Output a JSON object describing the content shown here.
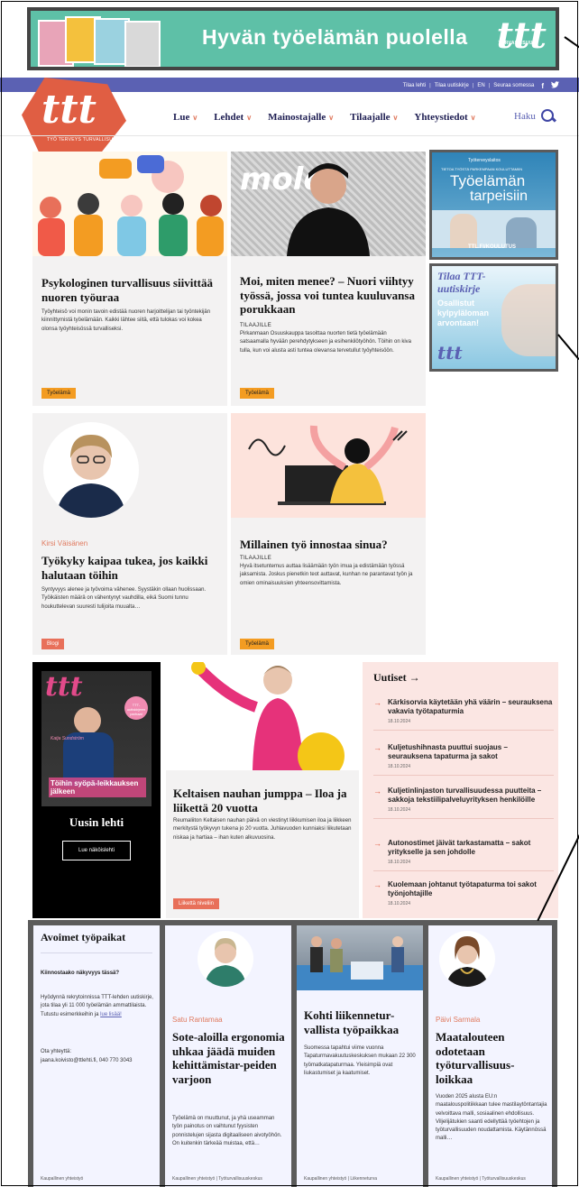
{
  "banner": {
    "text": "Hyvän työelämän puolella",
    "logo": "ttt",
    "logo_tagline": "TYÖ TERVEYS TURVALLISUUS"
  },
  "utility": {
    "links": [
      "Tilaa lehti",
      "Tilaa uutiskirje",
      "EN",
      "Seuraa somessa"
    ],
    "social": [
      "facebook-icon",
      "twitter-icon"
    ]
  },
  "logo": {
    "text": "ttt",
    "tagline": "TYÖ TERVEYS TURVALLISUUS"
  },
  "nav": [
    "Lue",
    "Lehdet",
    "Mainostajalle",
    "Tilaajalle",
    "Yhteystiedot"
  ],
  "search_label": "Haku",
  "cards": [
    {
      "title": "Psykologinen turvallisuus siivittää nuoren työuraa",
      "excerpt": "Työyhteisö voi monin tavoin edistää nuoren harjoittelijan tai työntekijän kiinnittymistä työelämään. Kaikki lähtee siitä, että tulokas voi kokea olonsa työyhteisössä turvalliseksi.",
      "tag": "Työelämä"
    },
    {
      "title": "Moi, miten menee? – Nuori viihtyy työssä, jossa voi tuntea kuuluvansa porukkaan",
      "overline": "TILAAJILLE",
      "excerpt": "Pirkanmaan Osuuskauppa tasoittaa nuorten tietä työelämään satsaamalla hyvään perehdytykseen ja esihenkilötyöhön. Töihin on kiva tulla, kun voi alusta asti tuntea olevansa tervetullut työyhteisöön.",
      "tag": "Työelämä"
    },
    {
      "byline": "Kirsi Väisänen",
      "title": "Työkyky kaipaa tukea, jos kaikki halutaan töihin",
      "excerpt": "Syntyvyys alenee ja työvoima vähenee. Syystäkin ollaan huolissaan. Työikäisten määrä on vähentynyt vauhdilla, eikä Suomi tunnu houkuttelevan suuresti tulijoita muualta…",
      "tag": "Blogi"
    },
    {
      "title": "Millainen työ innostaa sinua?",
      "overline": "TILAAJILLE",
      "excerpt": "Hyvä itsetuntemus auttaa lisäämään työn imua ja edistämään työssä jaksamista. Joskus pienetkin teot auttavat, kunhan ne parantavat työn ja omien ominaisuuksien yhteensovittamista.",
      "tag": "Työelämä"
    }
  ],
  "ads": {
    "ad1": {
      "small": "Työterveyslaitos",
      "sub": "TIETOA TYÖSTÄ PARKEMPAAN KOULUTTAMIIN",
      "title1": "Työelämän",
      "title2": "tarpeisiin",
      "foot": "TTL.FI/KOULUTUS"
    },
    "ad2": {
      "title1": "Tilaa TTT-",
      "title2": "uutiskirje",
      "body1": "Osallistut",
      "body2": "kylpyläloman",
      "body3": "arvontaan!",
      "logo": "ttt"
    }
  },
  "magazine": {
    "cover_logo": "ttt",
    "cover_name": "Katja Sundström",
    "cover_headline": "Töihin syöpä-leikkauksen jälkeen",
    "cover_badge": "TTT-uutiskirjeen parhaat",
    "label": "Uusin lehti",
    "button": "Lue näköislehti"
  },
  "feature": {
    "title": "Keltaisen nauhan jumppa – Iloa ja liikettä 20 vuotta",
    "excerpt": "Reumaliiton Keltaisen nauhan päivä on viestinyt liikkumisen iloa ja liikkeen merkitystä työkyvyn tukena jo 20 vuotta. Juhlavuoden kunniaksi liikutetaan niskaa ja hartiaa – ihan kuten alkuvuosina.",
    "tag": "Liikettä niveliin"
  },
  "news": {
    "heading": "Uutiset",
    "items": [
      {
        "title": "Kärkisorvia käytetään yhä väärin – seurauksena vakavia työtapaturmia",
        "date": "18.10.2024"
      },
      {
        "title": "Kuljetushihnasta puuttui suojaus – seurauksena tapaturma ja sakot",
        "date": "18.10.2024"
      },
      {
        "title": "Kuljetinlinjaston turvallisuudessa puutteita – sakkoja tekstiilipalveluyrityksen henkilöille",
        "date": "18.10.2024"
      },
      {
        "title": "Autonostimet jäivät tarkastamatta – sakot yritykselle ja sen johdolle",
        "date": "18.10.2024"
      },
      {
        "title": "Kuolemaan johtanut työtapaturma toi sakot työnjohtajille",
        "date": "18.10.2024"
      }
    ]
  },
  "jobs": {
    "heading": "Avoimet työpaikat",
    "lead": "Kiinnostaako näkyvyys tässä?",
    "body": "Hyödynnä rekrytoinnissa TTT-lehden uutiskirje, jota tilaa yli 11 000 työelämän ammattilaista. Tutustu esimerkkeihin ja",
    "link": "lue lisää!",
    "contact_label": "Ota yhteyttä:",
    "contact": "jaana.koivisto@ttlehti.fi, 040 770 3043",
    "foot": "Kaupallinen yhteistyö"
  },
  "promos": [
    {
      "byline": "Satu Rantamaa",
      "title": "Sote-aloilla ergonomia uhkaa jäädä muiden kehittämistar-peiden varjoon",
      "excerpt": "Työelämä on muuttunut, ja yhä useamman työn painotus on vaihtunut fyysisten ponnistelujen sijasta digitaaliseen aivotyöhön. On kuitenkin tärkeää muistaa, että…",
      "foot": "Kaupallinen yhteistyö | Työturvallisuuskeskus"
    },
    {
      "title": "Kohti liikennetur-vallista työpaikkaa",
      "excerpt": "Suomessa tapahtui viime vuonna Tapaturmavakuutuskeskuksen mukaan 22 300 työmatkatapaturmaa. Yleisimpiä ovat liukastumiset ja kaatumiset.",
      "foot": "Kaupallinen yhteistyö | Liikenneturva"
    },
    {
      "byline": "Päivi Sarmala",
      "title": "Maatalouteen odotetaan työturvallisuus-loikkaa",
      "excerpt": "Vuoden 2025 alusta EU:n maatalouspolitiikkaan tulee mastilaytöntantajia velvoittava malli, sosiaalinen ehdollisuus. Viljelijätukien saanti edellyttää työehtojen ja työturvallisuuden noudattamista. Käytännössä malli…",
      "foot": "Kaupallinen yhteistyö | Työturvallisuuskeskus"
    }
  ],
  "colors": {
    "accent": "#5b61b3",
    "brand": "#e05e43",
    "chip_orange": "#f39c22"
  }
}
